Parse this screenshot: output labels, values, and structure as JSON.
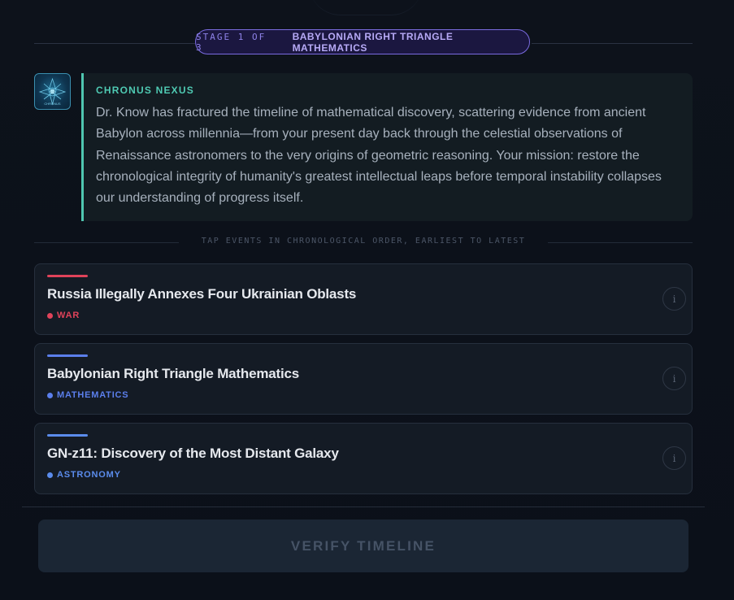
{
  "stage": {
    "counter": "STAGE 1 OF 3",
    "name": "BABYLONIAN RIGHT TRIANGLE MATHEMATICS"
  },
  "narrator": {
    "name": "CHRONUS NEXUS",
    "avatar_icon": "chronus-nexus-avatar-icon",
    "message": "Dr. Know has fractured the timeline of mathematical discovery, scattering evidence from ancient Babylon across millennia—from your present day back through the celestial observations of Renaissance astronomers to the very origins of geometric reasoning. Your mission: restore the chronological integrity of humanity's greatest intellectual leaps before temporal instability collapses our understanding of progress itself."
  },
  "instruction": "TAP EVENTS IN CHRONOLOGICAL ORDER, EARLIEST TO LATEST",
  "events": [
    {
      "title": "Russia Illegally Annexes Four Ukrainian Oblasts",
      "category": "WAR",
      "color": "#e0435a",
      "info_icon": "i"
    },
    {
      "title": "Babylonian Right Triangle Mathematics",
      "category": "MATHEMATICS",
      "color": "#5b7fec",
      "info_icon": "i"
    },
    {
      "title": "GN-z11: Discovery of the Most Distant Galaxy",
      "category": "ASTRONOMY",
      "color": "#5b8cec",
      "info_icon": "i"
    }
  ],
  "verify_button": "VERIFY TIMELINE",
  "colors": {
    "accent_teal": "#4fcab3",
    "accent_purple": "#7a6be0",
    "background": "#0c1119"
  }
}
